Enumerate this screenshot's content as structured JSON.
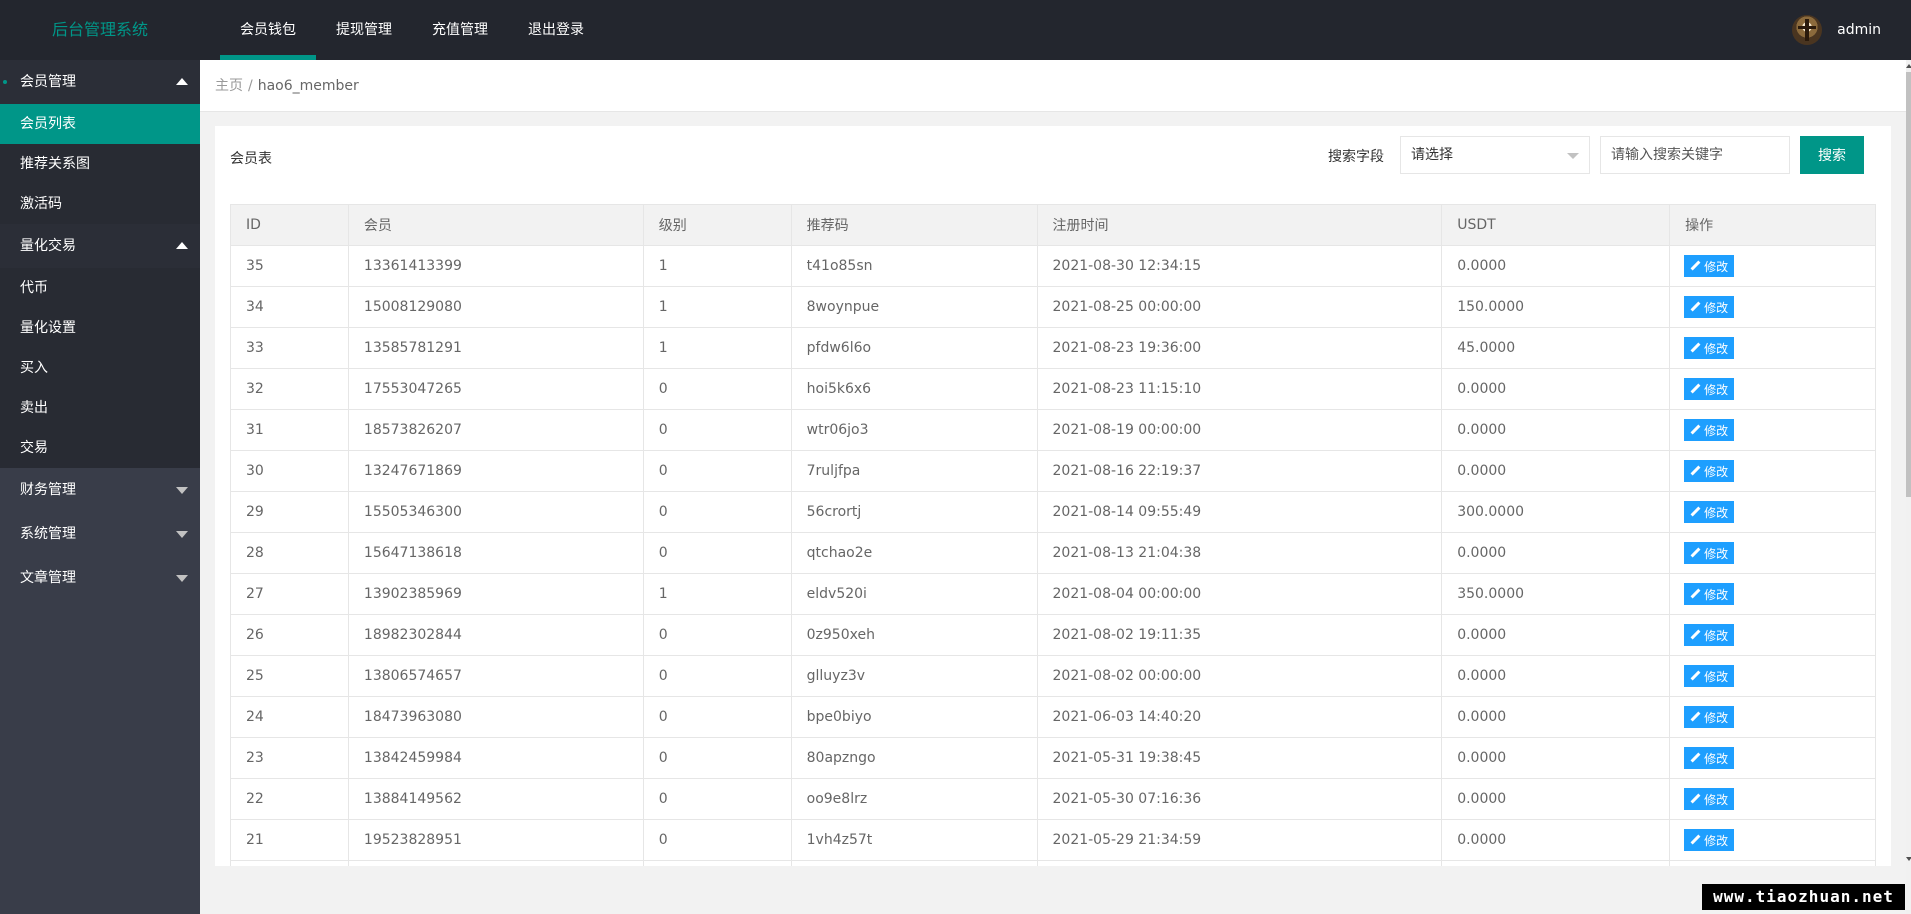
{
  "app": {
    "title": "后台管理系统"
  },
  "topnav": [
    {
      "label": "会员钱包",
      "active": true
    },
    {
      "label": "提现管理",
      "active": false
    },
    {
      "label": "充值管理",
      "active": false
    },
    {
      "label": "退出登录",
      "active": false
    }
  ],
  "user": {
    "name": "admin"
  },
  "sidebar": {
    "member": {
      "label": "会员管理",
      "items": [
        "会员列表",
        "推荐关系图",
        "激活码"
      ]
    },
    "quant": {
      "label": "量化交易",
      "items": [
        "代币",
        "量化设置",
        "买入",
        "卖出",
        "交易"
      ]
    },
    "finance": {
      "label": "财务管理"
    },
    "system": {
      "label": "系统管理"
    },
    "article": {
      "label": "文章管理"
    }
  },
  "breadcrumb": {
    "home": "主页",
    "separator": "/",
    "current": "hao6_member"
  },
  "card": {
    "title": "会员表"
  },
  "search": {
    "field_label": "搜索字段",
    "select_placeholder": "请选择",
    "input_placeholder": "请输入搜索关键字",
    "button": "搜索"
  },
  "table": {
    "columns": [
      "ID",
      "会员",
      "级别",
      "推荐码",
      "注册时间",
      "USDT",
      "操作"
    ],
    "edit_label": "修改",
    "rows": [
      [
        "35",
        "13361413399",
        "1",
        "t41o85sn",
        "2021-08-30 12:34:15",
        "0.0000"
      ],
      [
        "34",
        "15008129080",
        "1",
        "8woynpue",
        "2021-08-25 00:00:00",
        "150.0000"
      ],
      [
        "33",
        "13585781291",
        "1",
        "pfdw6l6o",
        "2021-08-23 19:36:00",
        "45.0000"
      ],
      [
        "32",
        "17553047265",
        "0",
        "hoi5k6x6",
        "2021-08-23 11:15:10",
        "0.0000"
      ],
      [
        "31",
        "18573826207",
        "0",
        "wtr06jo3",
        "2021-08-19 00:00:00",
        "0.0000"
      ],
      [
        "30",
        "13247671869",
        "0",
        "7ruljfpa",
        "2021-08-16 22:19:37",
        "0.0000"
      ],
      [
        "29",
        "15505346300",
        "0",
        "56crortj",
        "2021-08-14 09:55:49",
        "300.0000"
      ],
      [
        "28",
        "15647138618",
        "0",
        "qtchao2e",
        "2021-08-13 21:04:38",
        "0.0000"
      ],
      [
        "27",
        "13902385969",
        "1",
        "eldv520i",
        "2021-08-04 00:00:00",
        "350.0000"
      ],
      [
        "26",
        "18982302844",
        "0",
        "0z950xeh",
        "2021-08-02 19:11:35",
        "0.0000"
      ],
      [
        "25",
        "13806574657",
        "0",
        "glluyz3v",
        "2021-08-02 00:00:00",
        "0.0000"
      ],
      [
        "24",
        "18473963080",
        "0",
        "bpe0biyo",
        "2021-06-03 14:40:20",
        "0.0000"
      ],
      [
        "23",
        "13842459984",
        "0",
        "80apzngo",
        "2021-05-31 19:38:45",
        "0.0000"
      ],
      [
        "22",
        "13884149562",
        "0",
        "oo9e8lrz",
        "2021-05-30 07:16:36",
        "0.0000"
      ],
      [
        "21",
        "19523828951",
        "0",
        "1vh4z57t",
        "2021-05-29 21:34:59",
        "0.0000"
      ],
      [
        "",
        "",
        "",
        "",
        "",
        ""
      ]
    ]
  },
  "watermark": "www.tiaozhuan.net",
  "colors": {
    "accent": "#009688",
    "header": "#23262e",
    "sidebar": "#393d49",
    "edit_button": "#1e9fff"
  }
}
